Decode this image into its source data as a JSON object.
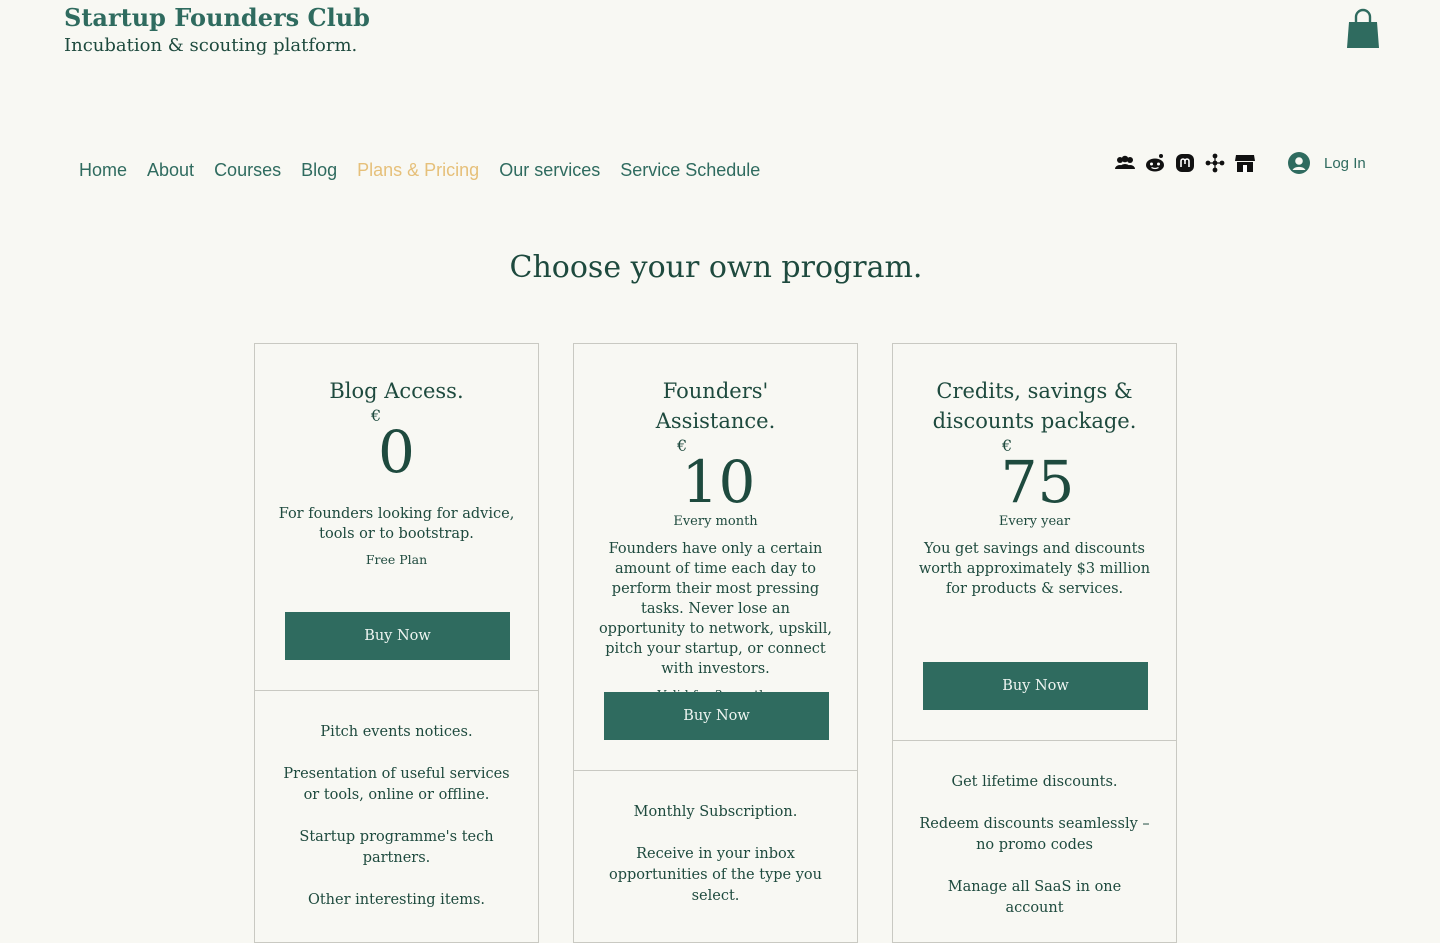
{
  "brand": {
    "title": "Startup Founders Club",
    "subtitle": "Incubation & scouting platform."
  },
  "nav": {
    "items": [
      "Home",
      "About",
      "Courses",
      "Blog",
      "Plans & Pricing",
      "Our services",
      "Service Schedule"
    ],
    "active": "Plans & Pricing"
  },
  "social": [
    "group-icon",
    "reddit-icon",
    "mastodon-icon",
    "network-icon",
    "store-icon"
  ],
  "login": {
    "label": "Log In"
  },
  "headline": "Choose your own program.",
  "colors": {
    "accent": "#2f6b5f",
    "active_nav": "#e6c07a",
    "background": "#f8f8f3",
    "text": "#1e4a3e"
  },
  "plans": [
    {
      "name": "Blog Access.",
      "currency": "€",
      "price": "0",
      "period": "",
      "description": "For founders looking for advice, tools or to bootstrap.",
      "validity": "Free Plan",
      "button": "Buy Now",
      "features": [
        "Pitch events notices.",
        "Presentation of useful services or tools, online or offline.",
        "Startup programme's tech partners.",
        "Other interesting items."
      ]
    },
    {
      "name": "Founders' Assistance.",
      "currency": "€",
      "price": "10",
      "period": "Every month",
      "description": "Founders have only a certain amount of time each day to perform their most pressing tasks. Never lose an opportunity to network, upskill, pitch your startup, or connect with investors.",
      "validity": "Valid for 3 months",
      "button": "Buy Now",
      "features": [
        "Monthly Subscription.",
        "Receive in your inbox opportunities of the type you select."
      ]
    },
    {
      "name": "Credits, savings & discounts package.",
      "currency": "€",
      "price": "75",
      "period": "Every year",
      "description": "You get savings and discounts worth approximately $3 million for products & services.",
      "validity": "",
      "button": "Buy Now",
      "features": [
        "Get lifetime discounts.",
        "Redeem discounts seamlessly – no promo codes",
        "Manage all SaaS in one account"
      ]
    }
  ]
}
